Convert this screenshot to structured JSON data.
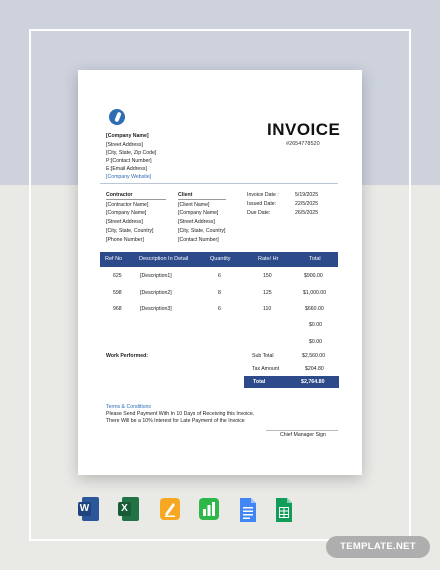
{
  "invoice": {
    "title": "INVOICE",
    "number": "#2654778520",
    "company": {
      "name": "[Company Name]",
      "street": "[Street Address]",
      "city": "[City, State, Zip Code]",
      "phone": "P:[Contact Number]",
      "email": "E:[Email Address]",
      "website": "[Company Website]"
    },
    "contractor": {
      "heading": "Contractor",
      "name": "[Contractor Name]",
      "company": "[Company Name]",
      "street": "[Street Address]",
      "city": "[City, State, Country]",
      "phone": "[Phone Number]"
    },
    "client": {
      "heading": "Client",
      "name": "[Client Name]",
      "company": "[Company Name]",
      "street": "[Street Address]",
      "city": "[City, State, Country]",
      "phone": "[Contact Number]"
    },
    "dates": [
      {
        "label": "Invoice Date :",
        "value": "5/19/2025"
      },
      {
        "label": "Issued Date:",
        "value": "22/5/2025"
      },
      {
        "label": "Due Date:",
        "value": "26/5/2025"
      }
    ],
    "table": {
      "headers": [
        "Ref No",
        "Description In Detail",
        "Quantity",
        "Rate/ Hr",
        "Total"
      ],
      "rows": [
        {
          "ref": "625",
          "desc": "[Description1]",
          "qty": "6",
          "rate": "150",
          "total": "$900.00"
        },
        {
          "ref": "598",
          "desc": "[Description2]",
          "qty": "8",
          "rate": "125",
          "total": "$1,000.00"
        },
        {
          "ref": "968",
          "desc": "[Description3]",
          "qty": "6",
          "rate": "110",
          "total": "$660.00"
        }
      ],
      "empty_totals": [
        "$0.00",
        "$0.00"
      ]
    },
    "work_performed_label": "Work Performed:",
    "subtotal": {
      "label": "Sub Total",
      "value": "$2,560.00"
    },
    "tax": {
      "label": "Tax Amount",
      "value": "$204.80"
    },
    "total": {
      "label": "Total",
      "value": "$2,764.80"
    },
    "terms": {
      "heading": "Terms & Conditions",
      "line1": "Please Send Payment With In 10 Days of Receiving this Invoice.",
      "line2": "There Will be a 10% Interest  for Late Payment  of the Invoice"
    },
    "signature_label": "Chief Manager Sign"
  },
  "app_icons": [
    {
      "name": "word-icon",
      "letter": "W",
      "color": "#2b579a"
    },
    {
      "name": "excel-icon",
      "letter": "X",
      "color": "#217346"
    },
    {
      "name": "pages-icon",
      "letter": "",
      "color": "#f7a823"
    },
    {
      "name": "numbers-icon",
      "letter": "",
      "color": "#2fb84a"
    },
    {
      "name": "google-docs-icon",
      "letter": "",
      "color": "#4285f4"
    },
    {
      "name": "google-sheets-icon",
      "letter": "",
      "color": "#0f9d58"
    }
  ],
  "watermark": "TEMPLATE.NET"
}
